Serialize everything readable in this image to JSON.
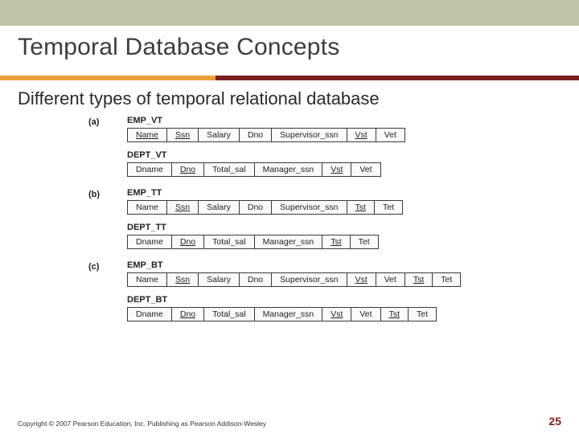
{
  "title": "Temporal Database Concepts",
  "subtitle": "Different types of temporal relational database",
  "sections": [
    {
      "letter": "(a)",
      "schemas": [
        {
          "name": "EMP_VT",
          "attrs": [
            {
              "n": "Name",
              "k": true
            },
            {
              "n": "Ssn",
              "k": true
            },
            {
              "n": "Salary"
            },
            {
              "n": "Dno"
            },
            {
              "n": "Supervisor_ssn"
            },
            {
              "n": "Vst",
              "k": true
            },
            {
              "n": "Vet"
            }
          ]
        },
        {
          "name": "DEPT_VT",
          "attrs": [
            {
              "n": "Dname"
            },
            {
              "n": "Dno",
              "k": true
            },
            {
              "n": "Total_sal"
            },
            {
              "n": "Manager_ssn"
            },
            {
              "n": "Vst",
              "k": true
            },
            {
              "n": "Vet"
            }
          ]
        }
      ]
    },
    {
      "letter": "(b)",
      "schemas": [
        {
          "name": "EMP_TT",
          "attrs": [
            {
              "n": "Name"
            },
            {
              "n": "Ssn",
              "k": true
            },
            {
              "n": "Salary"
            },
            {
              "n": "Dno"
            },
            {
              "n": "Supervisor_ssn"
            },
            {
              "n": "Tst",
              "k": true
            },
            {
              "n": "Tet"
            }
          ]
        },
        {
          "name": "DEPT_TT",
          "attrs": [
            {
              "n": "Dname"
            },
            {
              "n": "Dno",
              "k": true
            },
            {
              "n": "Total_sal"
            },
            {
              "n": "Manager_ssn"
            },
            {
              "n": "Tst",
              "k": true
            },
            {
              "n": "Tet"
            }
          ]
        }
      ]
    },
    {
      "letter": "(c)",
      "schemas": [
        {
          "name": "EMP_BT",
          "attrs": [
            {
              "n": "Name"
            },
            {
              "n": "Ssn",
              "k": true
            },
            {
              "n": "Salary"
            },
            {
              "n": "Dno"
            },
            {
              "n": "Supervisor_ssn"
            },
            {
              "n": "Vst",
              "k": true
            },
            {
              "n": "Vet"
            },
            {
              "n": "Tst",
              "k": true
            },
            {
              "n": "Tet"
            }
          ]
        },
        {
          "name": "DEPT_BT",
          "attrs": [
            {
              "n": "Dname"
            },
            {
              "n": "Dno",
              "k": true
            },
            {
              "n": "Total_sal"
            },
            {
              "n": "Manager_ssn"
            },
            {
              "n": "Vst",
              "k": true
            },
            {
              "n": "Vet"
            },
            {
              "n": "Tst",
              "k": true
            },
            {
              "n": "Tet"
            }
          ]
        }
      ]
    }
  ],
  "footer": {
    "copyright": "Copyright © 2007 Pearson Education, Inc. Publishing as Pearson Addison-Wesley",
    "page": "25"
  }
}
